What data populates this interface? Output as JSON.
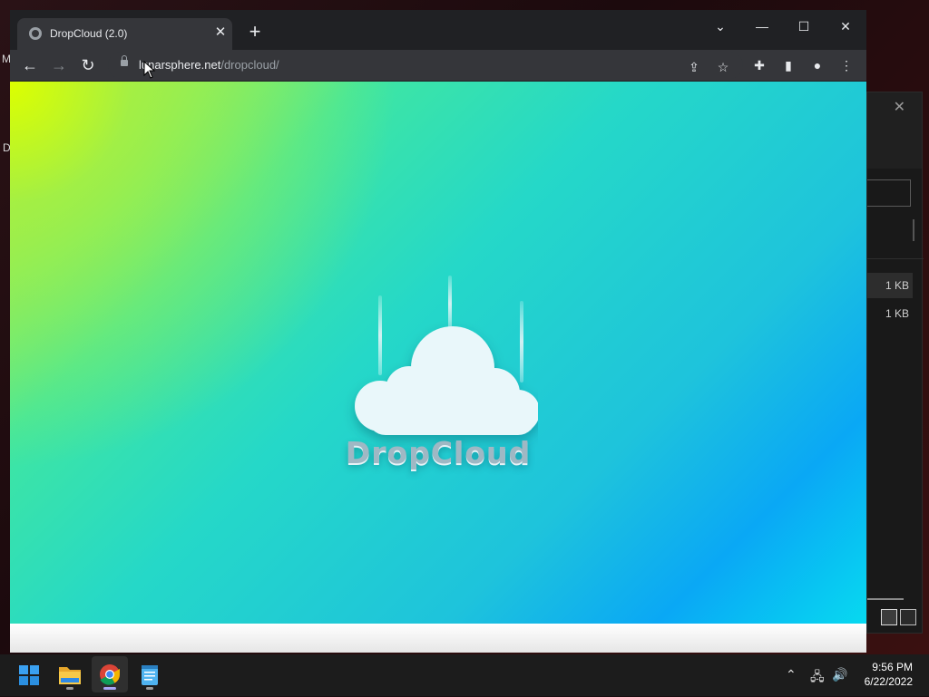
{
  "desktop": {
    "edge_letters": [
      "M",
      "D"
    ]
  },
  "explorer": {
    "close_glyph": "✕",
    "files": [
      {
        "size": "1 KB",
        "selected": true
      },
      {
        "size": "1 KB",
        "selected": false
      }
    ]
  },
  "browser": {
    "tab": {
      "title": "DropCloud (2.0)",
      "close_glyph": "✕"
    },
    "new_tab_glyph": "+",
    "window_controls": {
      "tab_search": "⌄",
      "minimize": "—",
      "maximize": "☐",
      "close": "✕"
    },
    "nav": {
      "back": "←",
      "forward": "→",
      "reload": "↻"
    },
    "address": {
      "host": "lunarsphere.net",
      "path": "/dropcloud/"
    },
    "toolbar_icons": {
      "share": "⇪",
      "bookmark": "☆",
      "extensions": "✚",
      "side_panel": "▮",
      "profile": "●",
      "menu": "⋮"
    }
  },
  "page": {
    "brand_name": "DropCloud",
    "colors": {
      "gradient_top_left": "#d8ff00",
      "gradient_mid": "#25d8c8",
      "gradient_bottom_right": "#0aa8f5",
      "cloud": "#e9f7fa"
    }
  },
  "taskbar": {
    "apps": [
      {
        "name": "start",
        "icon": "windows-start-icon"
      },
      {
        "name": "file-explorer",
        "icon": "folder-icon"
      },
      {
        "name": "chrome",
        "icon": "chrome-icon",
        "active": true
      },
      {
        "name": "notepad",
        "icon": "notepad-icon"
      }
    ],
    "tray_icons": {
      "chevron": "⌃",
      "network": "🖧",
      "volume": "🔊"
    },
    "time": "9:56 PM",
    "date": "6/22/2022"
  }
}
